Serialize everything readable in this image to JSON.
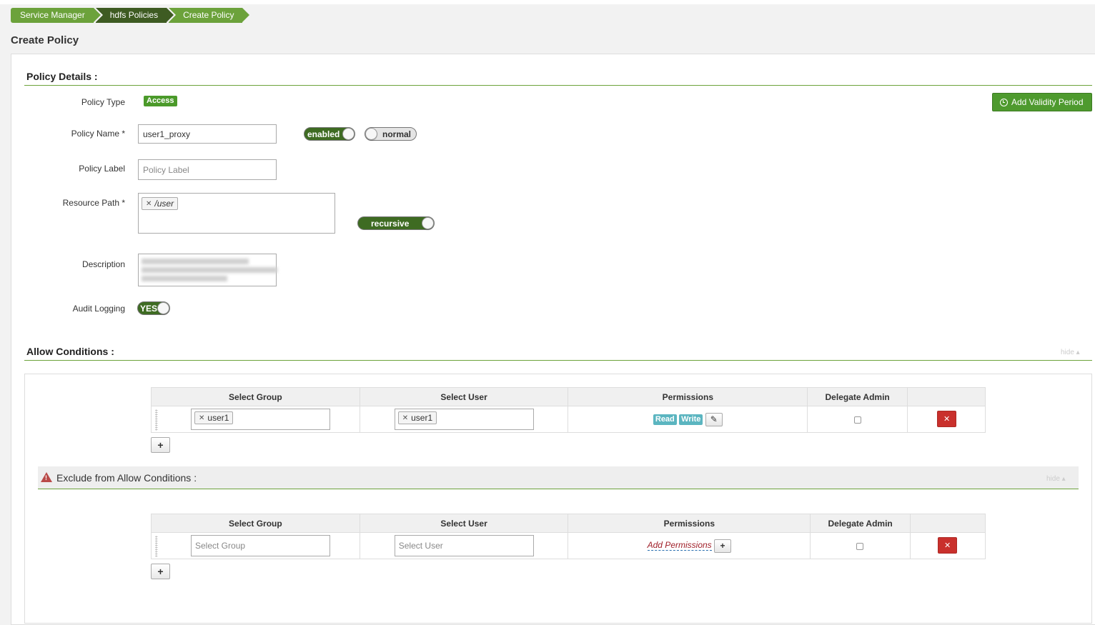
{
  "breadcrumb": [
    "Service Manager",
    "hdfs Policies",
    "Create Policy"
  ],
  "page_title": "Create Policy",
  "policy_details": {
    "title": "Policy Details :",
    "policy_type_label": "Policy Type",
    "policy_type_value": "Access",
    "add_validity_label": "Add Validity Period",
    "policy_name_label": "Policy Name *",
    "policy_name_value": "user1_proxy",
    "enabled_toggle": "enabled",
    "normal_toggle": "normal",
    "policy_label_label": "Policy Label",
    "policy_label_placeholder": "Policy Label",
    "resource_path_label": "Resource Path *",
    "resource_path_tag": "/user",
    "recursive_toggle": "recursive",
    "description_label": "Description",
    "audit_logging_label": "Audit Logging",
    "audit_logging_value": "YES"
  },
  "allow_conditions": {
    "title": "Allow Conditions :",
    "hide_label": "hide ▴",
    "headers": [
      "Select Group",
      "Select User",
      "Permissions",
      "Delegate Admin"
    ],
    "row": {
      "group_tag": "user1",
      "user_tag": "user1",
      "permissions": [
        "Read",
        "Write"
      ]
    }
  },
  "exclude_conditions": {
    "title": "Exclude from Allow Conditions :",
    "hide_label": "hide ▴",
    "headers": [
      "Select Group",
      "Select User",
      "Permissions",
      "Delegate Admin"
    ],
    "row": {
      "group_placeholder": "Select Group",
      "user_placeholder": "Select User",
      "add_permissions": "Add Permissions"
    }
  },
  "colors": {
    "accent_green": "#6ca23b",
    "dark_green": "#3e5b22",
    "danger_red": "#c9302c",
    "permission_teal": "#5bb5c0"
  },
  "icons": [
    "clock-icon",
    "edit-pencil-icon",
    "plus-icon",
    "remove-x-icon",
    "warning-icon",
    "drag-handle-icon"
  ]
}
